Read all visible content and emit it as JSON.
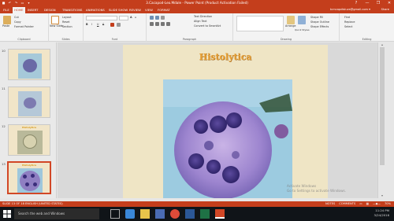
{
  "window": {
    "title": "3.Cacapod-Leo.Mdale - Power Point (Product Activation Failed)",
    "qat": [
      "save-icon",
      "undo-icon",
      "redo-icon",
      "present-icon",
      "more-icon"
    ],
    "controls": [
      "?",
      "—",
      "❐",
      "✕"
    ]
  },
  "tabs": [
    "FILE",
    "HOME",
    "INSERT",
    "DESIGN",
    "TRANSITIONS",
    "ANIMATIONS",
    "SLIDE SHOW",
    "REVIEW",
    "VIEW",
    "FORMAT"
  ],
  "active_tab": "HOME",
  "account": {
    "user": "tcmcapdisluvs@gmail.com ▾",
    "share": "Share"
  },
  "ribbon": {
    "clipboard": {
      "paste": "Paste",
      "cut": "Cut",
      "copy": "Copy",
      "format_painter": "Format Painter",
      "label": "Clipboard"
    },
    "slides": {
      "new_slide": "New Slide",
      "layout": "Layout",
      "reset": "Reset",
      "section": "Section",
      "label": "Slides"
    },
    "font": {
      "bold": "B",
      "italic": "I",
      "underline": "U",
      "strike": "S",
      "size_up": "A",
      "size_down": "A",
      "label": "Font"
    },
    "paragraph": {
      "text_direction": "Text Direction",
      "align_text": "Align Text",
      "smartart": "Convert to SmartArt",
      "label": "Paragraph"
    },
    "drawing": {
      "arrange": "Arrange",
      "quick_styles": "Quick Styles",
      "fill": "Shape Fill",
      "outline": "Shape Outline",
      "effects": "Shape Effects",
      "label": "Drawing"
    },
    "editing": {
      "find": "Find",
      "replace": "Replace",
      "select": "Select",
      "label": "Editing"
    }
  },
  "thumbnails": [
    {
      "number": "10",
      "caption": ""
    },
    {
      "number": "11",
      "caption": ""
    },
    {
      "number": "12",
      "caption": "Histolytica"
    },
    {
      "number": "13",
      "caption": "Histolytica"
    }
  ],
  "selected_slide": 3,
  "slide": {
    "title": "Histolytica"
  },
  "statusbar": {
    "left": "SLIDE 13 OF 18    ENGLISH (UNITED STATES)",
    "notes": "NOTES",
    "comments": "COMMENTS",
    "zoom": "70%"
  },
  "watermark": {
    "line1": "Activate Windows",
    "line2": "Go to Settings to activate Windows."
  },
  "taskbar": {
    "search_placeholder": "Search the web and Windows",
    "time": "11:24 PM",
    "date": "3/24/2016",
    "apps": [
      "task-view-icon",
      "edge-icon",
      "explorer-icon",
      "store-icon",
      "chrome-icon",
      "word-icon",
      "excel-icon",
      "powerpoint-icon"
    ]
  },
  "colors": {
    "accent": "#c43e1c",
    "slide_bg": "#efe5c5",
    "title": "#e8a33a"
  }
}
